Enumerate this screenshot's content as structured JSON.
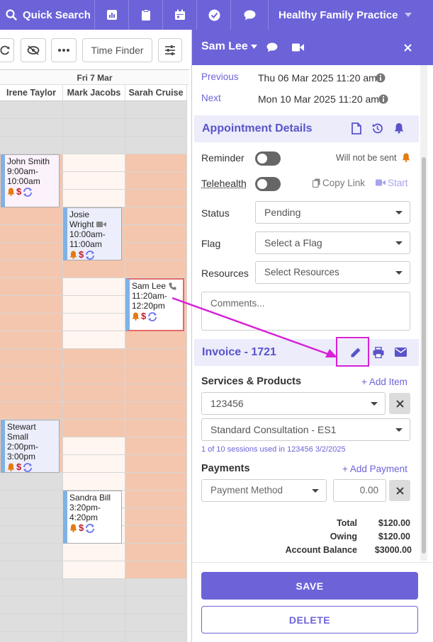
{
  "topbar": {
    "search_label": "Quick Search",
    "practice_name": "Healthy Family Practice",
    "icons": [
      "chart-icon",
      "clipboard-icon",
      "calendar-icon",
      "check-circle-icon",
      "chat-icon"
    ]
  },
  "toolbar": {
    "time_finder_label": "Time Finder"
  },
  "calendar": {
    "day_label": "Fri 7 Mar",
    "columns": [
      "Irene Taylor",
      "Mark Jacobs",
      "Sarah Cruise"
    ],
    "appointments": [
      {
        "line1": "John Smith",
        "line2": "9:00am-",
        "line3": "10:00am"
      },
      {
        "line1": "Josie",
        "line2": "Wright",
        "line3": "10:00am-",
        "line4": "11:00am"
      },
      {
        "line1": "Sam Lee",
        "line2": "11:20am-",
        "line3": "12:20pm"
      },
      {
        "line1": "Stewart",
        "line2": "Small",
        "line3": "2:00pm-",
        "line4": "3:00pm"
      },
      {
        "line1": "Sandra Bill",
        "line2": "3:20pm-",
        "line3": "4:20pm"
      }
    ],
    "dollar_symbol": "$"
  },
  "panel": {
    "patient_name": "Sam Lee",
    "previous_label": "Previous",
    "previous_value": "Thu 06 Mar 2025 11:20 am",
    "next_label": "Next",
    "next_value": "Mon 10 Mar 2025 11:20 am",
    "appointment_details_title": "Appointment Details",
    "reminder_label": "Reminder",
    "reminder_status": "Will not be sent",
    "telehealth_label": "Telehealth",
    "copy_link_label": "Copy Link",
    "start_label": "Start",
    "status_label": "Status",
    "status_value": "Pending",
    "flag_label": "Flag",
    "flag_placeholder": "Select a Flag",
    "resources_label": "Resources",
    "resources_placeholder": "Select Resources",
    "comments_placeholder": "Comments...",
    "invoice_title": "Invoice - 1721",
    "services_title": "Services & Products",
    "add_item_label": "+ Add Item",
    "service_code": "123456",
    "service_name": "Standard Consultation - ES1",
    "sessions_note": "1 of 10 sessions used in 123456 3/2/2025",
    "payments_title": "Payments",
    "add_payment_label": "+ Add Payment",
    "payment_method_placeholder": "Payment Method",
    "payment_amount": "0.00",
    "totals": [
      {
        "label": "Total",
        "value": "$120.00"
      },
      {
        "label": "Owing",
        "value": "$120.00"
      },
      {
        "label": "Account Balance",
        "value": "$3000.00"
      }
    ],
    "save_label": "SAVE",
    "delete_label": "DELETE"
  },
  "colors": {
    "brand": "#6c63d9",
    "peach": "#f4c6ad",
    "grey_slot": "#dedede",
    "light_slot": "#fff6f1",
    "annotation": "#d621d6",
    "appt_border_highlight": "#e46a6a"
  }
}
